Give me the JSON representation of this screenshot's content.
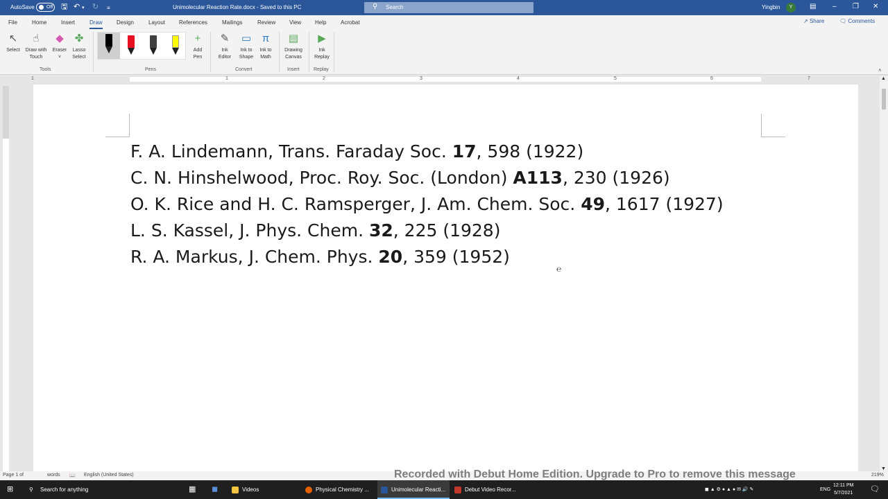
{
  "titlebar": {
    "autosave_label": "AutoSave",
    "autosave_state": "Off",
    "doc_title": "Unimolecular Reaction Rate.docx - Saved to this PC",
    "search_placeholder": "Search",
    "user_name": "Yingbin",
    "user_initial": "Y"
  },
  "tabs": [
    "File",
    "Home",
    "Insert",
    "Draw",
    "Design",
    "Layout",
    "References",
    "Mailings",
    "Review",
    "View",
    "Help",
    "Acrobat"
  ],
  "active_tab": "Draw",
  "share_label": "Share",
  "comments_label": "Comments",
  "ribbon": {
    "tools": {
      "select": "Select",
      "draw_touch_1": "Draw with",
      "draw_touch_2": "Touch",
      "eraser": "Eraser",
      "lasso_1": "Lasso",
      "lasso_2": "Select",
      "group": "Tools"
    },
    "pens": {
      "add_pen_1": "Add",
      "add_pen_2": "Pen",
      "group": "Pens",
      "colors": [
        "#000000",
        "#e81123",
        "#404040",
        "#ffff00"
      ]
    },
    "convert": {
      "ink_editor_1": "Ink",
      "ink_editor_2": "Editor",
      "ink_shape_1": "Ink to",
      "ink_shape_2": "Shape",
      "ink_math_1": "Ink to",
      "ink_math_2": "Math",
      "group": "Convert"
    },
    "insert": {
      "canvas_1": "Drawing",
      "canvas_2": "Canvas",
      "group": "Insert"
    },
    "replay": {
      "replay_1": "Ink",
      "replay_2": "Replay",
      "group": "Replay"
    }
  },
  "ruler_numbers": [
    "1",
    "1",
    "2",
    "3",
    "4",
    "5",
    "6",
    "7"
  ],
  "document": {
    "references": [
      {
        "pre": "F. A. Lindemann, Trans. Faraday Soc. ",
        "bold": "17",
        "post": ", 598 (1922)"
      },
      {
        "pre": "C. N. Hinshelwood, Proc. Roy. Soc. (London) ",
        "bold": "A113",
        "post": ", 230 (1926)"
      },
      {
        "pre": "O. K. Rice and H. C. Ramsperger, J. Am. Chem. Soc. ",
        "bold": "49",
        "post": ", 1617 (1927)"
      },
      {
        "pre": "L. S. Kassel, J. Phys. Chem. ",
        "bold": "32",
        "post": ", 225 (1928)"
      },
      {
        "pre": "R. A. Markus, J. Chem. Phys. ",
        "bold": "20",
        "post": ", 359 (1952)"
      }
    ]
  },
  "statusbar": {
    "page": "Page 1 of",
    "words": "words",
    "language": "English (United States)",
    "zoom": "219%"
  },
  "watermark": "Recorded with Debut Home Edition. Upgrade to Pro to remove this message",
  "taskbar": {
    "search": "Search for anything",
    "apps": [
      {
        "label": "Videos",
        "color": "#f4c542"
      },
      {
        "label": "Physical Chemistry ...",
        "color": "#e66000"
      },
      {
        "label": "Unimolecular Reacti...",
        "color": "#2b579a"
      },
      {
        "label": "Debut Video Recor...",
        "color": "#c0392b"
      }
    ],
    "lang": "ENG",
    "time": "12:11 PM",
    "date": "5/7/2021"
  }
}
